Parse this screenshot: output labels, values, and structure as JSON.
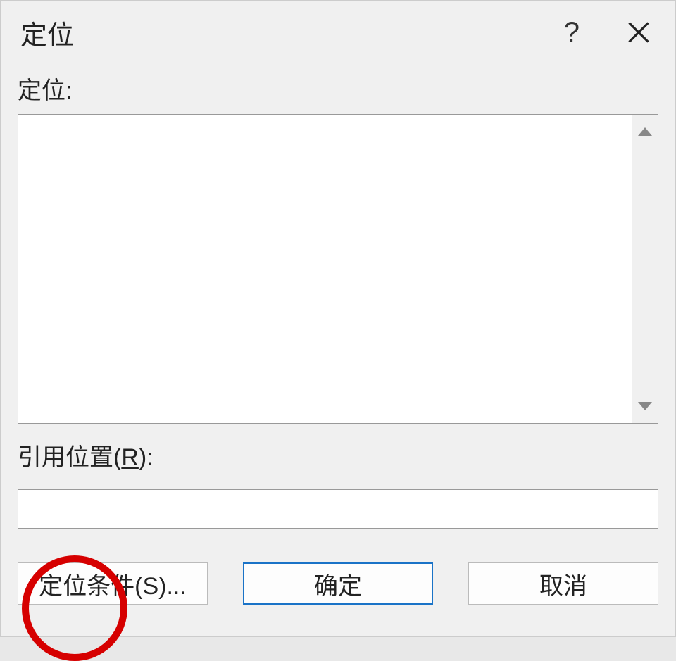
{
  "dialog": {
    "title": "定位",
    "help_label": "?",
    "goto_label": "定位:",
    "reference_label_prefix": "引用位置(",
    "reference_label_key": "R",
    "reference_label_suffix": "):",
    "reference_value": "",
    "buttons": {
      "special_label": "定位条件(S)...",
      "ok_label": "确定",
      "cancel_label": "取消"
    }
  }
}
